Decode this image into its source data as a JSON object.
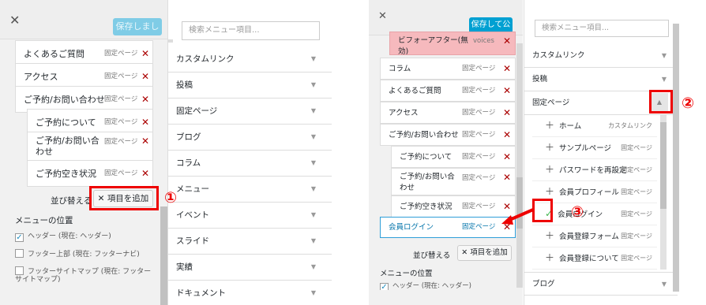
{
  "left": {
    "save_label": "保存しました",
    "menu_items": [
      {
        "label": "よくあるご質問",
        "type": "固定ページ"
      },
      {
        "label": "アクセス",
        "type": "固定ページ"
      },
      {
        "label": "ご予約/お問い合わせ",
        "type": "固定ページ"
      },
      {
        "label": "ご予約について",
        "type": "固定ページ"
      },
      {
        "label": "ご予約/お問い合わせ",
        "type": "固定ページ"
      },
      {
        "label": "ご予約空き状況",
        "type": "固定ページ"
      }
    ],
    "reorder_label": "並び替える",
    "add_items_label": "項目を追加",
    "locations_heading": "メニューの位置",
    "locations": [
      {
        "label": "ヘッダー",
        "note": "(現在: ヘッダー)",
        "checked": true
      },
      {
        "label": "フッター上部",
        "note": "(現在: フッターナビ)",
        "checked": false
      },
      {
        "label": "フッターサイトマップ",
        "note": "(現在: フッターサイトマップ)",
        "checked": false
      }
    ],
    "search_placeholder": "検索メニュー項目...",
    "sections": [
      "カスタムリンク",
      "投稿",
      "固定ページ",
      "ブログ",
      "コラム",
      "メニュー",
      "イベント",
      "スライド",
      "実績",
      "ドキュメント"
    ],
    "annotation": "①"
  },
  "right": {
    "save_label": "保存して公開",
    "truncated_item": {
      "label": "ビフォーアフター(無効)",
      "type": "voices"
    },
    "menu_items": [
      {
        "label": "コラム",
        "type": "固定ページ"
      },
      {
        "label": "よくあるご質問",
        "type": "固定ページ"
      },
      {
        "label": "アクセス",
        "type": "固定ページ"
      },
      {
        "label": "ご予約/お問い合わせ",
        "type": "固定ページ"
      },
      {
        "label": "ご予約について",
        "type": "固定ページ"
      },
      {
        "label": "ご予約/お問い合わせ",
        "type": "固定ページ"
      },
      {
        "label": "ご予約空き状況",
        "type": "固定ページ"
      }
    ],
    "new_item": {
      "label": "会員ログイン",
      "type": "固定ページ"
    },
    "reorder_label": "並び替える",
    "add_items_label": "項目を追加",
    "locations_heading": "メニューの位置",
    "location_partial": "ヘッダー (現在: ヘッダー)",
    "search_placeholder": "検索メニュー項目...",
    "sections_top": [
      "カスタムリンク",
      "投稿"
    ],
    "open_section": "固定ページ",
    "pages": [
      {
        "label": "ホーム",
        "type": "カスタムリンク",
        "added": false
      },
      {
        "label": "サンプルページ",
        "type": "固定ページ",
        "added": false
      },
      {
        "label": "パスワードを再設定",
        "type": "固定ページ",
        "added": false
      },
      {
        "label": "会員プロフィール",
        "type": "固定ページ",
        "added": false
      },
      {
        "label": "会員ログイン",
        "type": "固定ページ",
        "added": true
      },
      {
        "label": "会員登録フォーム",
        "type": "固定ページ",
        "added": false
      },
      {
        "label": "会員登録について",
        "type": "固定ページ",
        "added": false
      }
    ],
    "bottom_section": "ブログ",
    "annotations": [
      "②",
      "③"
    ]
  }
}
